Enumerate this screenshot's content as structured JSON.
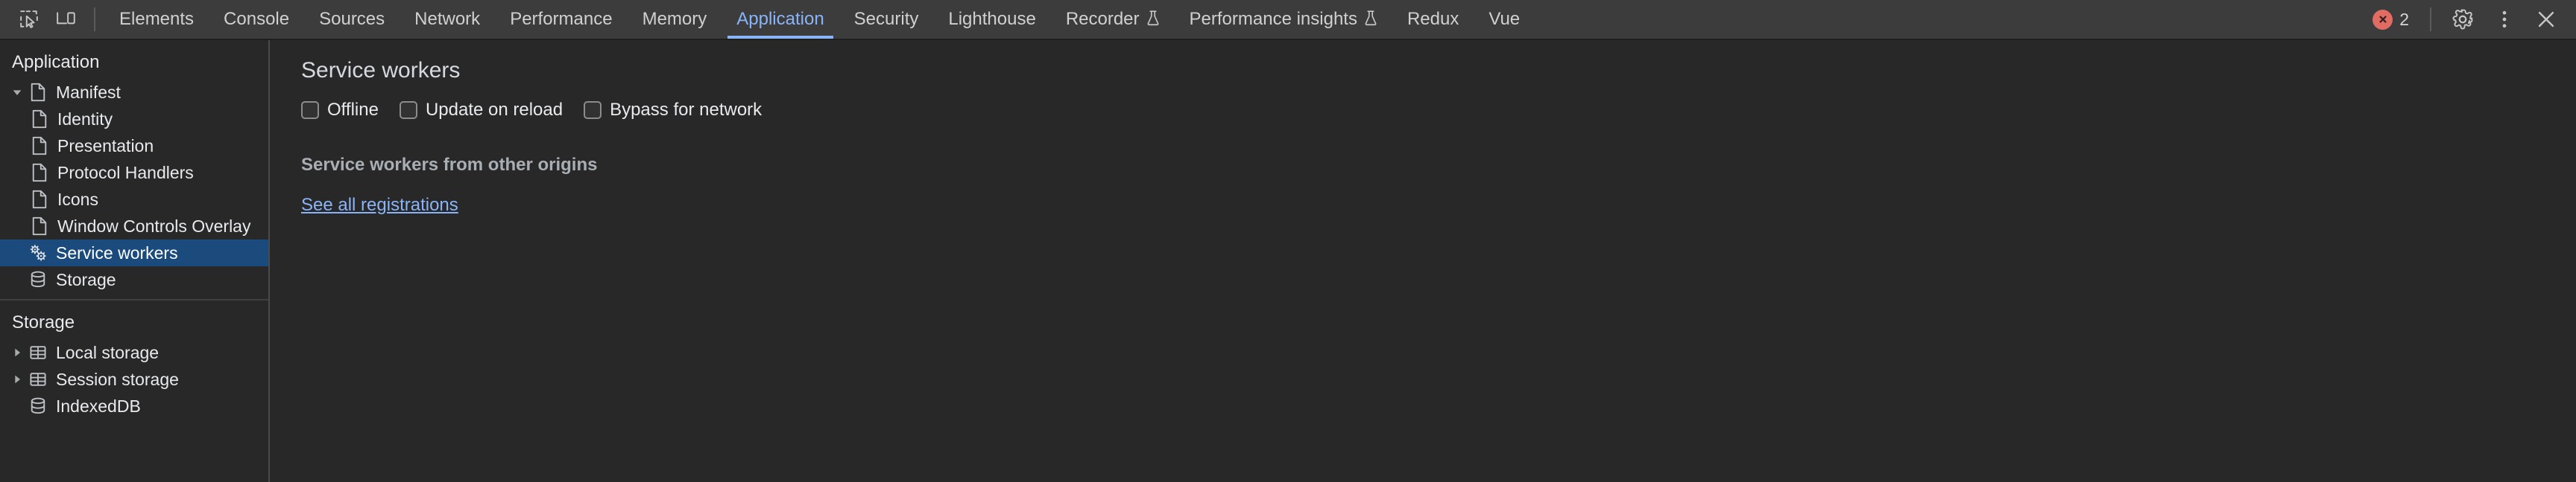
{
  "toolbar": {
    "inspect_icon": "inspect-element-icon",
    "device_icon": "device-toolbar-icon",
    "error_count": "2",
    "error_icon": "error-circle-icon",
    "settings_icon": "gear-icon",
    "more_icon": "kebab-menu-icon",
    "close_icon": "close-icon"
  },
  "tabs": [
    {
      "label": "Elements",
      "active": false,
      "experimental": false
    },
    {
      "label": "Console",
      "active": false,
      "experimental": false
    },
    {
      "label": "Sources",
      "active": false,
      "experimental": false
    },
    {
      "label": "Network",
      "active": false,
      "experimental": false
    },
    {
      "label": "Performance",
      "active": false,
      "experimental": false
    },
    {
      "label": "Memory",
      "active": false,
      "experimental": false
    },
    {
      "label": "Application",
      "active": true,
      "experimental": false
    },
    {
      "label": "Security",
      "active": false,
      "experimental": false
    },
    {
      "label": "Lighthouse",
      "active": false,
      "experimental": false
    },
    {
      "label": "Recorder",
      "active": false,
      "experimental": true
    },
    {
      "label": "Performance insights",
      "active": false,
      "experimental": true
    },
    {
      "label": "Redux",
      "active": false,
      "experimental": false
    },
    {
      "label": "Vue",
      "active": false,
      "experimental": false
    }
  ],
  "sidebar": {
    "sections": [
      {
        "title": "Application",
        "items": [
          {
            "label": "Manifest",
            "icon": "document-icon",
            "indent": 0,
            "twisty": "expanded",
            "selected": false
          },
          {
            "label": "Identity",
            "icon": "document-icon",
            "indent": 1,
            "twisty": "none",
            "selected": false
          },
          {
            "label": "Presentation",
            "icon": "document-icon",
            "indent": 1,
            "twisty": "none",
            "selected": false
          },
          {
            "label": "Protocol Handlers",
            "icon": "document-icon",
            "indent": 1,
            "twisty": "none",
            "selected": false
          },
          {
            "label": "Icons",
            "icon": "document-icon",
            "indent": 1,
            "twisty": "none",
            "selected": false
          },
          {
            "label": "Window Controls Overlay",
            "icon": "document-icon",
            "indent": 1,
            "twisty": "none",
            "selected": false
          },
          {
            "label": "Service workers",
            "icon": "gears-icon",
            "indent": 0,
            "twisty": "none",
            "selected": true
          },
          {
            "label": "Storage",
            "icon": "database-icon",
            "indent": 0,
            "twisty": "none",
            "selected": false
          }
        ]
      },
      {
        "title": "Storage",
        "items": [
          {
            "label": "Local storage",
            "icon": "table-icon",
            "indent": 0,
            "twisty": "collapsed",
            "selected": false
          },
          {
            "label": "Session storage",
            "icon": "table-icon",
            "indent": 0,
            "twisty": "collapsed",
            "selected": false
          },
          {
            "label": "IndexedDB",
            "icon": "database-icon",
            "indent": 0,
            "twisty": "none",
            "selected": false
          }
        ]
      }
    ]
  },
  "main": {
    "title": "Service workers",
    "checkboxes": [
      {
        "label": "Offline",
        "checked": false
      },
      {
        "label": "Update on reload",
        "checked": false
      },
      {
        "label": "Bypass for network",
        "checked": false
      }
    ],
    "other_origins_title": "Service workers from other origins",
    "registrations_link": "See all registrations"
  },
  "colors": {
    "accent": "#8ab4f8",
    "selection": "#1a4b7c",
    "error": "#e06c64",
    "background": "#282828",
    "tabbar": "#3c3c3c"
  }
}
